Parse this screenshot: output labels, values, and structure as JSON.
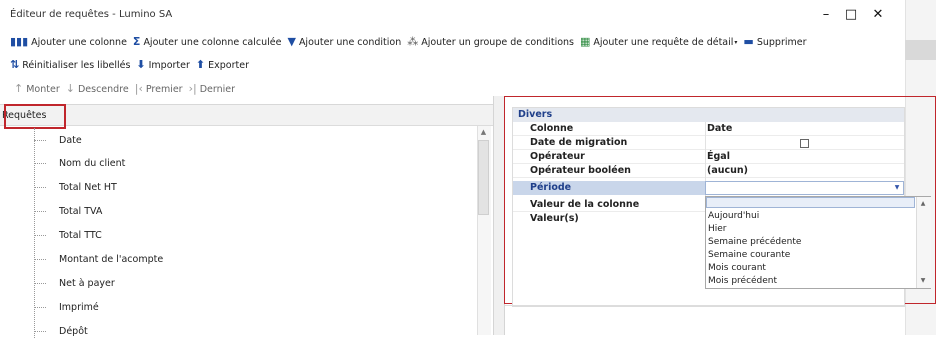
{
  "window": {
    "title": "Éditeur de requêtes - Lumino SA",
    "controls": {
      "minimize": "–",
      "maximize": "□",
      "close": "✕"
    }
  },
  "toolbar": {
    "row1": [
      {
        "icon": "columns-icon",
        "glyph": "▮▮▮",
        "label": "Ajouter une colonne"
      },
      {
        "icon": "sum-icon",
        "glyph": "Σ",
        "label": "Ajouter une colonne calculée"
      },
      {
        "icon": "filter-icon",
        "glyph": "▼",
        "label": "Ajouter une condition"
      },
      {
        "icon": "group-conditions-icon",
        "glyph": "⁂",
        "label": "Ajouter un groupe de conditions"
      },
      {
        "icon": "detail-query-icon",
        "glyph": "▦",
        "label": "Ajouter une requête de détail"
      },
      {
        "icon": "trash-icon",
        "glyph": "▬",
        "label": "Supprimer"
      }
    ],
    "row2": [
      {
        "icon": "reset-labels-icon",
        "glyph": "⇅",
        "label": "Réinitialiser les libellés"
      },
      {
        "icon": "import-icon",
        "glyph": "⬇",
        "label": "Importer"
      },
      {
        "icon": "export-icon",
        "glyph": "⬆",
        "label": "Exporter"
      }
    ],
    "row3": [
      {
        "icon": "arrow-up-icon",
        "glyph": "↑",
        "label": "Monter"
      },
      {
        "icon": "arrow-down-icon",
        "glyph": "↓",
        "label": "Descendre"
      },
      {
        "icon": "first-icon",
        "glyph": "|‹",
        "label": "Premier"
      },
      {
        "icon": "last-icon",
        "glyph": "›|",
        "label": "Dernier"
      }
    ]
  },
  "left_panel": {
    "header": "Requêtes",
    "items": [
      "Date",
      "Nom du client",
      "Total Net HT",
      "Total TVA",
      "Total TTC",
      "Montant de l'acompte",
      "Net à payer",
      "Imprimé",
      "Dépôt"
    ]
  },
  "properties": {
    "category": "Divers",
    "rows": [
      {
        "name": "Colonne",
        "value": "Date"
      },
      {
        "name": "Date de migration",
        "value": ""
      },
      {
        "name": "Opérateur",
        "value": "Égal"
      },
      {
        "name": "Opérateur booléen",
        "value": "(aucun)"
      },
      {
        "name": "Période",
        "value": ""
      },
      {
        "name": "Valeur de la colonne",
        "value": ""
      },
      {
        "name": "Valeur(s)",
        "value": ""
      }
    ],
    "periode_options": [
      "Aujourd'hui",
      "Hier",
      "Semaine précédente",
      "Semaine courante",
      "Mois courant",
      "Mois précédent"
    ]
  }
}
